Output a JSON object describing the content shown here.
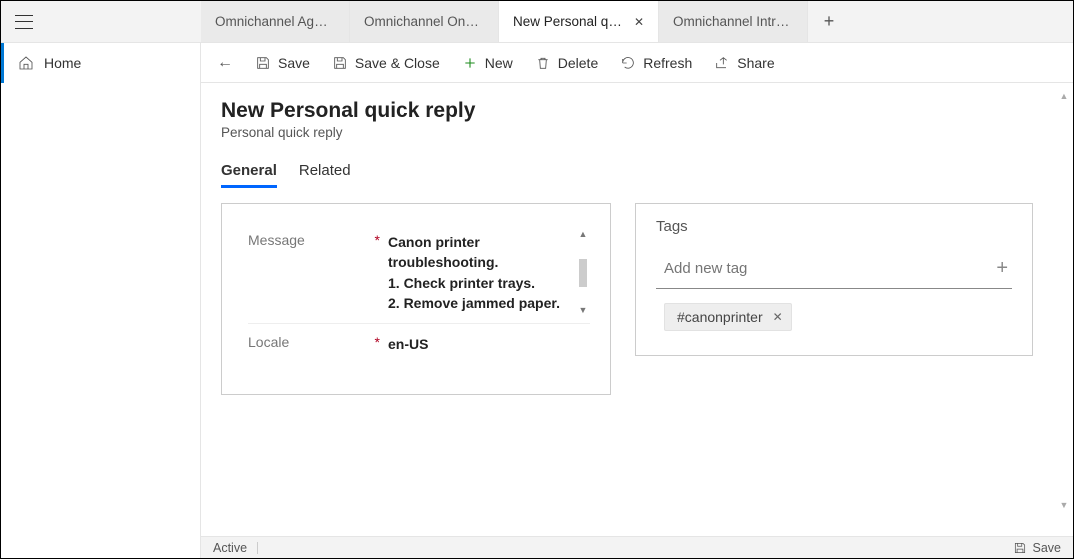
{
  "nav": {
    "home": "Home"
  },
  "tabs": [
    {
      "label": "Omnichannel Age…"
    },
    {
      "label": "Omnichannel Ong…"
    },
    {
      "label": "New Personal quick reply"
    },
    {
      "label": "Omnichannel Intra…"
    }
  ],
  "commands": {
    "save": "Save",
    "saveclose": "Save & Close",
    "new": "New",
    "delete": "Delete",
    "refresh": "Refresh",
    "share": "Share"
  },
  "header": {
    "title": "New Personal quick reply",
    "subtitle": "Personal quick reply"
  },
  "formTabs": {
    "general": "General",
    "related": "Related"
  },
  "fields": {
    "message": {
      "label": "Message",
      "value": "Canon printer troubleshooting.\n1. Check printer trays.\n2. Remove jammed paper."
    },
    "locale": {
      "label": "Locale",
      "value": "en-US"
    }
  },
  "tagsPanel": {
    "title": "Tags",
    "placeholder": "Add new tag",
    "chips": [
      "#canonprinter"
    ]
  },
  "footer": {
    "status": "Active",
    "save": "Save"
  }
}
